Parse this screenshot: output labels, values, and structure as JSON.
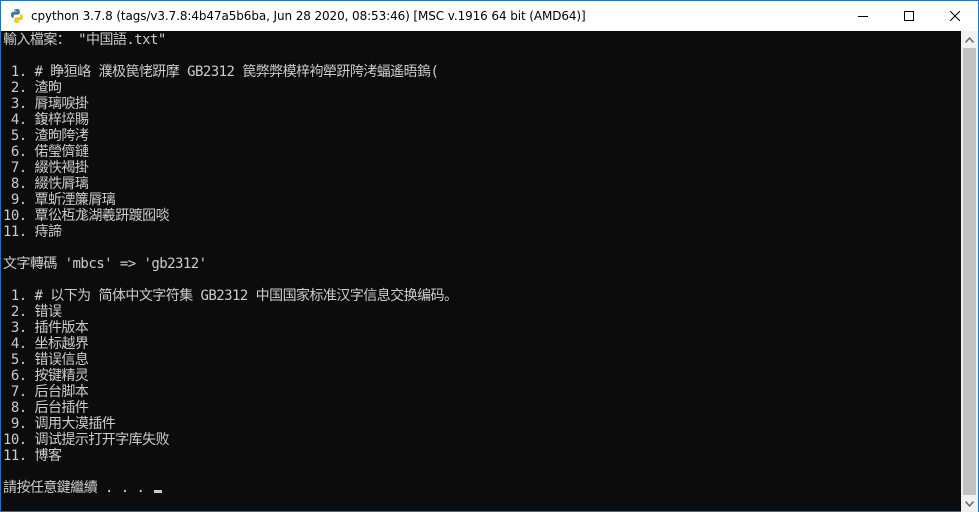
{
  "window": {
    "title": "cpython 3.7.8 (tags/v3.7.8:4b47a5b6ba, Jun 28 2020, 08:53:46) [MSC v.1916 64 bit (AMD64)]",
    "app_icon": "python-icon",
    "controls": {
      "minimize": "minimize-icon",
      "maximize": "maximize-icon",
      "close": "close-icon"
    }
  },
  "console": {
    "lines": [
      "輸入檔案： \"中国語.txt\"",
      "",
      " 1. # 睁狟峈 濮极笢恅趼摩 GB2312 笢弊弊模梓袧犖趼陓洘蝠遙晤鎢(",
      " 2. 渣昫",
      " 3. 脣璃唳掛",
      " 4. 鍑梓埣賜",
      " 5. 渣昫陓洘",
      " 6. 偌瑩儕鏈",
      " 7. 綴怢褐掛",
      " 8. 綴怢脣璃",
      " 9. 覃蚚湮簾脣璃",
      "10. 覃彸枑尨湖羲趼踱囮啖",
      "11. 痔諦",
      "",
      "文字轉碼 'mbcs' => 'gb2312'",
      "",
      " 1. # 以下为 简体中文字符集 GB2312 中国国家标准汉字信息交换编码。",
      " 2. 错误",
      " 3. 插件版本",
      " 4. 坐标越界",
      " 5. 错误信息",
      " 6. 按键精灵",
      " 7. 后台脚本",
      " 8. 后台插件",
      " 9. 调用大漠插件",
      "10. 调试提示打开字库失败",
      "11. 博客",
      "",
      "請按任意鍵繼續 . . . "
    ]
  },
  "colors": {
    "console_bg": "#0c0c0c",
    "console_fg": "#cccccc",
    "titlebar_bg": "#ffffff",
    "border": "#1a73c9",
    "scrollbar_bg": "#f0f0f0",
    "scrollbar_thumb": "#c1c1c1"
  }
}
